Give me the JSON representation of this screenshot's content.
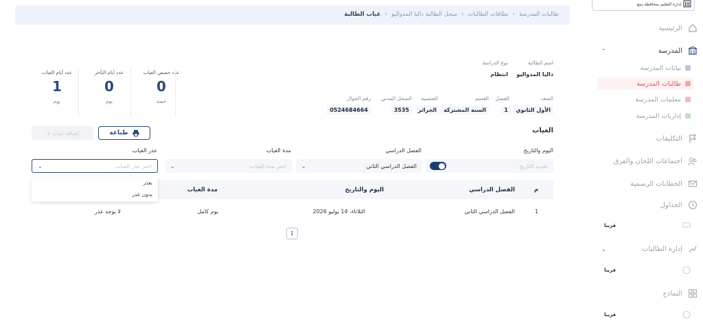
{
  "sidebar": {
    "top_label": "إدارة التعليم بمحافظة ينبع",
    "items": [
      {
        "label": "الرئيسية",
        "icon": "home-icon"
      },
      {
        "label": "المدرسة",
        "icon": "school-icon"
      },
      {
        "label": "التكليفات",
        "icon": "flag-icon"
      },
      {
        "label": "اجتماعات اللجان والفرق",
        "icon": "users-icon"
      },
      {
        "label": "الخطابات الرسمية",
        "icon": "mail-icon"
      },
      {
        "label": "الجداول",
        "icon": "clock-icon"
      },
      {
        "label": "إدارة الطالبات",
        "icon": "chart-icon"
      },
      {
        "label": "النماذج",
        "icon": "grid-icon"
      }
    ],
    "school_subitems": [
      {
        "label": "بيانات المدرسة",
        "color": "#b9c7e0"
      },
      {
        "label": "طالبات المدرسة",
        "color": "#f3a6a6"
      },
      {
        "label": "معلمات المدرسة",
        "color": "#f6bcbc"
      },
      {
        "label": "إداريات المدرسة",
        "color": "#bfe3bf"
      }
    ],
    "soon_label": "قريبا"
  },
  "breadcrumb": {
    "items": [
      "طالبات المدرسة",
      "بطاقات الطالبات",
      "سجل الطالبة داليا المدواليو"
    ],
    "current": "غياب الطالبة"
  },
  "student": {
    "name_label": "اسم الطالبة",
    "name": "داليا المدواليو",
    "study_type_label": "نوع الدراسة",
    "study_type": "انتظام",
    "grade_label": "الصف",
    "grade": "الأول الثانوي",
    "class_label": "الفصل",
    "class": "1",
    "track_label": "القسم",
    "track": "السنة المشتركة",
    "nationality_label": "الجنسية",
    "nationality": "الجزائر",
    "civil_id_label": "السجل المدني",
    "civil_id": "3535",
    "mobile_label": "رقم الجوال",
    "mobile": "0524684664"
  },
  "stats": [
    {
      "label": "عدد حصص الغياب",
      "value": "0",
      "unit": "حصة"
    },
    {
      "label": "عدد أيام التأخر",
      "value": "0",
      "unit": "يوم"
    },
    {
      "label": "عدد أيام الغياب",
      "value": "1",
      "unit": "يوم"
    }
  ],
  "section_title": "الغياب",
  "buttons": {
    "print": "طباعة",
    "add": "+ إضافة غياب"
  },
  "filters": {
    "date_label": "اليوم والتاريخ",
    "date_placeholder": "تحديد التاريخ",
    "semester_label": "الفصل الدراسي",
    "semester_value": "الفصل الدراسي الثاني",
    "duration_label": "مدة الغياب",
    "duration_placeholder": "اختر مدة الغياب",
    "excuse_label": "عذر الغياب",
    "excuse_placeholder": "اختر عذر الغياب",
    "excuse_options": [
      "بعذر",
      "بدون عذر"
    ]
  },
  "table": {
    "headers": [
      "م",
      "الفصل الدراسي",
      "اليوم والتاريخ",
      "مدة الغياب",
      "عذر الغياب"
    ],
    "rows": [
      [
        "1",
        "الفصل الدراسي الثاني",
        "الثلاثاء، 14 يوليو 2026",
        "يوم كامل",
        "لا يوجد عذر"
      ]
    ]
  },
  "pagination": {
    "current": "1"
  }
}
